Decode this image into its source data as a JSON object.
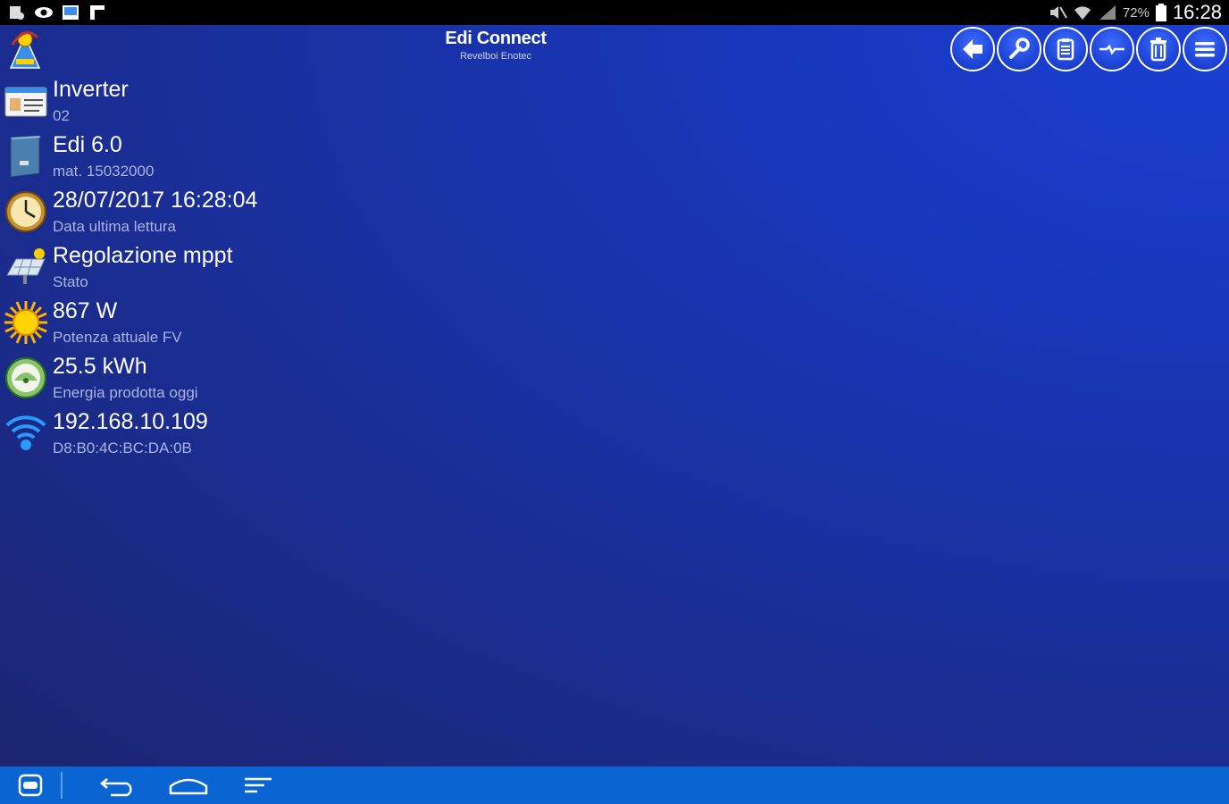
{
  "status_bar": {
    "battery_percent": "72%",
    "time": "16:28",
    "left_icons": [
      "usb-debug-icon",
      "eye-icon",
      "gallery-icon",
      "flipboard-icon"
    ],
    "right_icons": [
      "mute-icon",
      "wifi-icon",
      "signal-icon",
      "battery-icon"
    ]
  },
  "app": {
    "title": "Edi Connect",
    "subtitle": "Revelboi Enotec",
    "toolbar": [
      {
        "name": "back-button",
        "icon": "arrow-left-icon"
      },
      {
        "name": "settings-button",
        "icon": "wrench-icon"
      },
      {
        "name": "clipboard-button",
        "icon": "clipboard-icon"
      },
      {
        "name": "waveform-button",
        "icon": "waveform-icon"
      },
      {
        "name": "delete-button",
        "icon": "trash-icon"
      },
      {
        "name": "menu-button",
        "icon": "hamburger-icon"
      }
    ]
  },
  "items": [
    {
      "value": "Inverter",
      "sub": "02",
      "icon": "id-card-icon"
    },
    {
      "value": "Edi 6.0",
      "sub": "mat. 15032000",
      "icon": "inverter-device-icon"
    },
    {
      "value": "28/07/2017 16:28:04",
      "sub": "Data ultima lettura",
      "icon": "clock-icon"
    },
    {
      "value": "Regolazione mppt",
      "sub": "Stato",
      "icon": "solar-panel-icon"
    },
    {
      "value": "867 W",
      "sub": "Potenza attuale FV",
      "icon": "sun-icon"
    },
    {
      "value": "25.5 kWh",
      "sub": "Energia prodotta oggi",
      "icon": "energy-meter-icon"
    },
    {
      "value": "192.168.10.109",
      "sub": "D8:B0:4C:BC:DA:0B",
      "icon": "wifi-icon"
    }
  ],
  "colors": {
    "status_bar": "#000000",
    "background_top": "#1a3fd4",
    "background_bottom": "#1b2570",
    "nav_bar": "#0a64d2",
    "subtext": "#aab4e6"
  },
  "nav_bar": [
    "app-switch-icon",
    "back-icon",
    "home-icon",
    "recents-icon"
  ]
}
